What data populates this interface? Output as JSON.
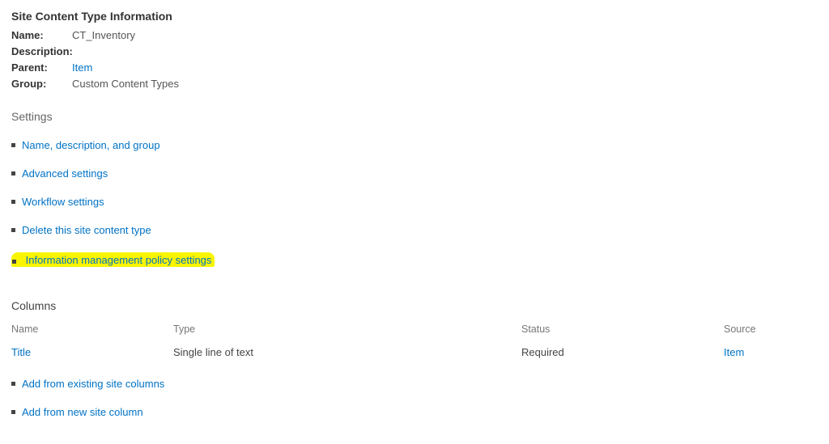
{
  "header": {
    "title": "Site Content Type Information",
    "rows": {
      "name_label": "Name:",
      "name_value": "CT_Inventory",
      "description_label": "Description:",
      "description_value": "",
      "parent_label": "Parent:",
      "parent_value": "Item",
      "group_label": "Group:",
      "group_value": "Custom Content Types"
    }
  },
  "settings": {
    "heading": "Settings",
    "items": [
      {
        "label": "Name, description, and group"
      },
      {
        "label": "Advanced settings"
      },
      {
        "label": "Workflow settings"
      },
      {
        "label": "Delete this site content type"
      },
      {
        "label": "Information management policy settings"
      }
    ]
  },
  "columns": {
    "heading": "Columns",
    "header": {
      "name": "Name",
      "type": "Type",
      "status": "Status",
      "source": "Source"
    },
    "rows": [
      {
        "name": "Title",
        "type": "Single line of text",
        "status": "Required",
        "source": "Item"
      }
    ],
    "actions": [
      {
        "label": "Add from existing site columns"
      },
      {
        "label": "Add from new site column"
      }
    ]
  }
}
